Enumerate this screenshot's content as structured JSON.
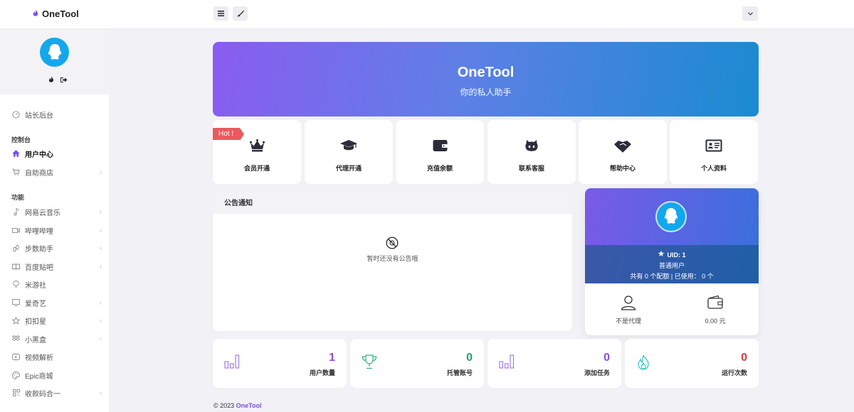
{
  "brand": {
    "name": "OneTool"
  },
  "sidebar": {
    "top_item": {
      "label": "站长后台",
      "icon": "gauge-icon"
    },
    "section_console": "控制台",
    "console_items": [
      {
        "label": "用户中心",
        "icon": "home-icon"
      },
      {
        "label": "自助商店",
        "icon": "cart-icon"
      }
    ],
    "section_features": "功能",
    "feature_items": [
      {
        "label": "网易云音乐",
        "icon": "music-icon"
      },
      {
        "label": "哔哩哔哩",
        "icon": "video-icon"
      },
      {
        "label": "步数助手",
        "icon": "footprint-icon"
      },
      {
        "label": "百度贴吧",
        "icon": "book-icon"
      },
      {
        "label": "米游社",
        "icon": "balloon-icon"
      },
      {
        "label": "爱奇艺",
        "icon": "monitor-icon"
      },
      {
        "label": "扣扣星",
        "icon": "star-icon"
      },
      {
        "label": "小黑盒",
        "icon": "dropbox-icon"
      },
      {
        "label": "视频解析",
        "icon": "play-icon"
      },
      {
        "label": "Epic商城",
        "icon": "palette-icon"
      },
      {
        "label": "收款码合一",
        "icon": "qrcode-icon"
      }
    ]
  },
  "banner": {
    "title": "OneTool",
    "subtitle": "你的私人助手"
  },
  "tiles": {
    "hot_badge": "Hot !",
    "items": [
      {
        "label": "会员开通",
        "icon": "crown-icon"
      },
      {
        "label": "代理开通",
        "icon": "graduation-cap-icon"
      },
      {
        "label": "充值余额",
        "icon": "wallet-icon"
      },
      {
        "label": "联系客服",
        "icon": "github-icon"
      },
      {
        "label": "帮助中心",
        "icon": "handshake-icon"
      },
      {
        "label": "个人资料",
        "icon": "id-card-icon"
      }
    ]
  },
  "notice": {
    "title": "公告通知",
    "empty_text": "暂时还没有公告哦"
  },
  "user_card": {
    "uid": "UID: 1",
    "role": "普通用户",
    "quota": "共有 0 个配额 | 已使用： 0 个",
    "agent_label": "不是代理",
    "balance": "0.00 元"
  },
  "stats": [
    {
      "value": "1",
      "label": "用户数量",
      "color": "#8b4ddf",
      "icon": "bar-chart-icon"
    },
    {
      "value": "0",
      "label": "托管账号",
      "color": "#22a56b",
      "icon": "trophy-icon"
    },
    {
      "value": "0",
      "label": "添加任务",
      "color": "#8b4ddf",
      "icon": "bar-chart-icon"
    },
    {
      "value": "0",
      "label": "运行次数",
      "color": "#e23b3b",
      "icon": "fire-icon"
    }
  ],
  "footer": {
    "copyright": "© 2023",
    "brand": "OneTool"
  }
}
